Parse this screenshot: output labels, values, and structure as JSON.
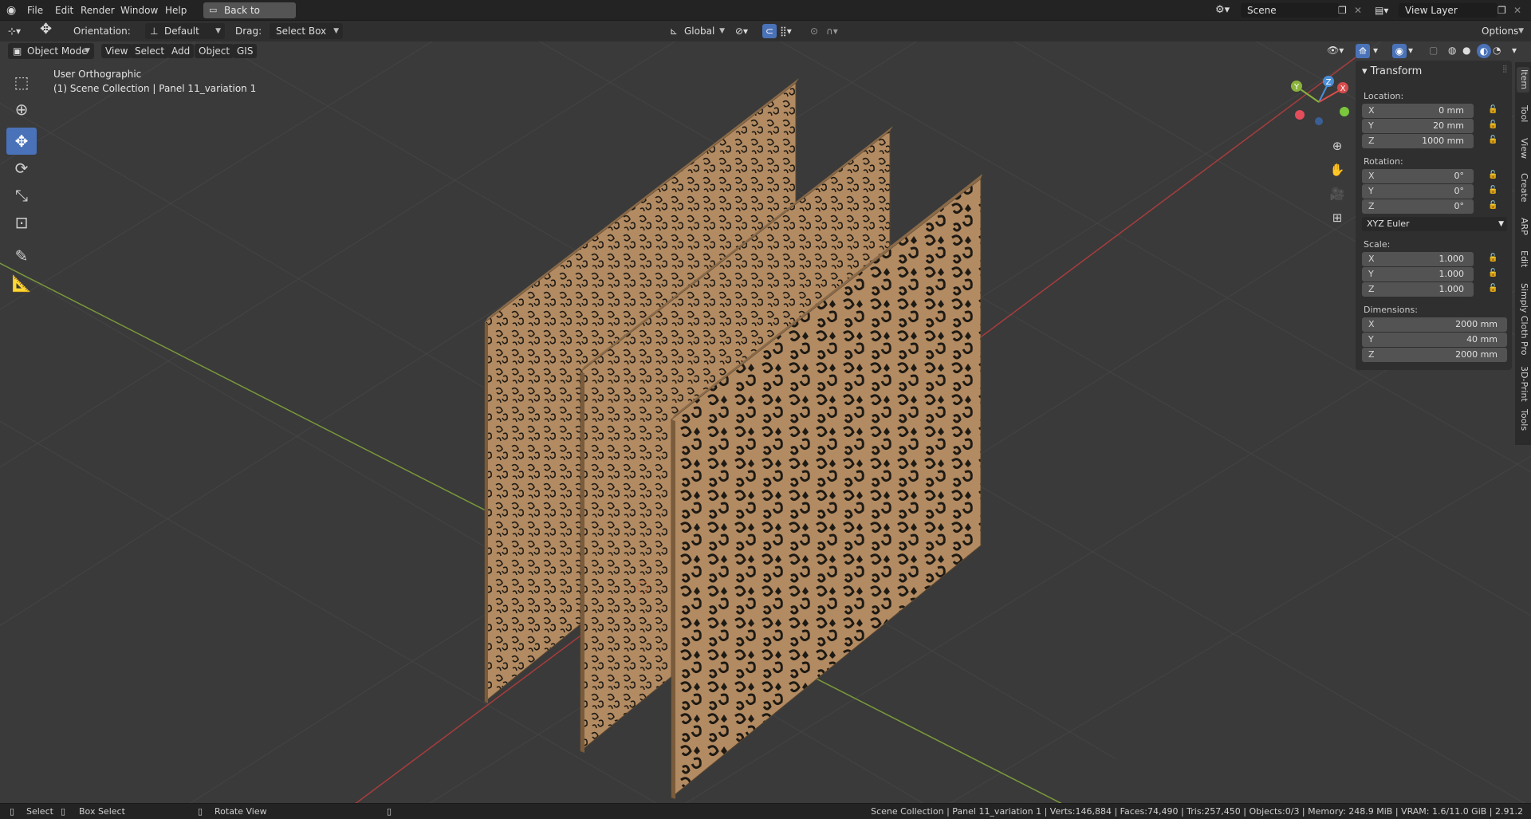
{
  "topmenu": {
    "app_icon": "blender-logo-icon",
    "items": [
      "File",
      "Edit",
      "Render",
      "Window",
      "Help"
    ],
    "back_button": "Back to Previous",
    "scene_label": "Scene",
    "view_layer_label": "View Layer"
  },
  "header": {
    "orientation_label": "Orientation:",
    "orientation_value": "Default",
    "drag_label": "Drag:",
    "drag_value": "Select Box",
    "transform_orientation": "Global",
    "options_label": "Options"
  },
  "viewport_header": {
    "mode": "Object Mode",
    "menus": [
      "View",
      "Select",
      "Add",
      "Object",
      "GIS"
    ]
  },
  "overlay": {
    "view_name": "User Orthographic",
    "collection_info": "(1) Scene Collection | Panel 11_variation 1"
  },
  "gizmo": {
    "x": "X",
    "y": "Y",
    "z": "Z"
  },
  "npanel": {
    "title": "Transform",
    "location_label": "Location:",
    "location": [
      {
        "axis": "X",
        "value": "0 mm"
      },
      {
        "axis": "Y",
        "value": "20 mm"
      },
      {
        "axis": "Z",
        "value": "1000 mm"
      }
    ],
    "rotation_label": "Rotation:",
    "rotation": [
      {
        "axis": "X",
        "value": "0°"
      },
      {
        "axis": "Y",
        "value": "0°"
      },
      {
        "axis": "Z",
        "value": "0°"
      }
    ],
    "rotation_mode": "XYZ Euler",
    "scale_label": "Scale:",
    "scale": [
      {
        "axis": "X",
        "value": "1.000"
      },
      {
        "axis": "Y",
        "value": "1.000"
      },
      {
        "axis": "Z",
        "value": "1.000"
      }
    ],
    "dimensions_label": "Dimensions:",
    "dimensions": [
      {
        "axis": "X",
        "value": "2000 mm"
      },
      {
        "axis": "Y",
        "value": "40 mm"
      },
      {
        "axis": "Z",
        "value": "2000 mm"
      }
    ]
  },
  "side_tabs": [
    "Item",
    "Tool",
    "View",
    "Create",
    "ARP",
    "Edit",
    "Simply Cloth Pro",
    "3D-Print",
    "Tools"
  ],
  "statusbar": {
    "select": "Select",
    "box_select": "Box Select",
    "rotate_view": "Rotate View",
    "stats": "Scene Collection | Panel 11_variation 1 | Verts:146,884 | Faces:74,490 | Tris:257,450 | Objects:0/3 | Memory: 248.9 MiB | VRAM: 1.6/11.0 GiB | 2.91.2"
  },
  "colors": {
    "accent": "#4a72b8",
    "x_axis": "#d94c4c",
    "y_axis": "#8ab33c",
    "z_axis": "#4a8fd9",
    "panel_wood": "#b08a62"
  }
}
